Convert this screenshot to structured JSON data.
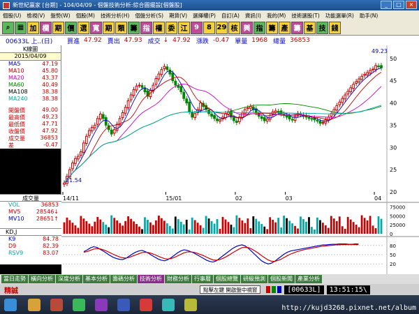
{
  "window": {
    "title": "新世紀贏家 [台期] - 104/04/09 - 個盤技術分析:綜合圖擺設[個盤股]"
  },
  "menu": [
    "個股(U)",
    "檢視(V)",
    "盤勢(W)",
    "個股(M)",
    "技術分析(H)",
    "個盤分析(S)",
    "期貨(V)",
    "選擇權(P)",
    "自訂(A)",
    "資訊(I)",
    "我的(M)",
    "技術選股(T)",
    "功能選單(R)",
    "助手(N)"
  ],
  "toolbar": [
    "加",
    "欄",
    "期",
    "價",
    "選",
    "寬",
    "期",
    "類",
    "籌",
    "指",
    "權",
    "委",
    "江",
    "9",
    "8",
    "29",
    "核",
    "興",
    "指",
    "籌",
    "產",
    "籌",
    "基",
    "技",
    "錢"
  ],
  "info": {
    "symbol": "00633L 上..(日)",
    "buy_label": "買進",
    "buy": "47.92",
    "sell_label": "賣出",
    "sell": "47.93",
    "trade_label": "成交",
    "trade": "47.92",
    "change_label": "漲跌",
    "change": "-0.47",
    "vol_label": "單量",
    "vol": "1968",
    "total_label": "總量",
    "total": "36853"
  },
  "side": {
    "header": "K線圖",
    "date": "2015/04/09",
    "ma": [
      {
        "label": "MA5",
        "value": "47.19",
        "color": "#0000cc"
      },
      {
        "label": "MA10",
        "value": "45.80",
        "color": "#cc0000"
      },
      {
        "label": "MA20",
        "value": "43.37",
        "color": "#cc00cc"
      },
      {
        "label": "MA60",
        "value": "40.49",
        "color": "#008800"
      },
      {
        "label": "MA108",
        "value": "38.38",
        "color": "#000000"
      },
      {
        "label": "MA240",
        "value": "38.38",
        "color": "#00aaaa"
      }
    ],
    "quote": [
      {
        "label": "開盤價",
        "value": "49.00"
      },
      {
        "label": "最高價",
        "value": "49.23"
      },
      {
        "label": "最低價",
        "value": "47.71"
      },
      {
        "label": "收盤價",
        "value": "47.92"
      },
      {
        "label": "成交量",
        "value": "36853"
      },
      {
        "label": "差",
        "value": "-0.47"
      }
    ]
  },
  "vol_panel": {
    "header": "成交量",
    "rows": [
      {
        "label": "VOL",
        "value": "36853",
        "color": "#00aaaa"
      },
      {
        "label": "MV5",
        "value": "28546↓",
        "color": "#cc0000"
      },
      {
        "label": "MV10",
        "value": "28651↑",
        "color": "#0000cc"
      }
    ]
  },
  "kd_panel": {
    "header": "KD,J",
    "rows": [
      {
        "label": "K9",
        "value": "84.78",
        "color": "#0000cc"
      },
      {
        "label": "D9",
        "value": "82.39",
        "color": "#cc0000"
      },
      {
        "label": "RSV9",
        "value": "83.07",
        "color": "#00aaaa"
      }
    ]
  },
  "chart_data": {
    "type": "candlestick",
    "price_axis": {
      "ticks": [
        "50",
        "45",
        "40",
        "35",
        "30",
        "25",
        "20"
      ],
      "min": 20,
      "max": 52
    },
    "x_ticks": [
      {
        "label": "14/11",
        "i": 0
      },
      {
        "label": "15/01",
        "i": 37
      },
      {
        "label": "02",
        "i": 62
      },
      {
        "label": "03",
        "i": 80
      },
      {
        "label": "04",
        "i": 112
      }
    ],
    "annotations": {
      "high": "49.23",
      "low": "21.54"
    },
    "closes": [
      22.0,
      23.5,
      25.0,
      26.5,
      27.5,
      28.0,
      29.0,
      31.0,
      32.5,
      33.8,
      34.5,
      35.0,
      36.5,
      37.5,
      36.5,
      35.0,
      34.0,
      33.0,
      34.0,
      35.2,
      36.5,
      37.8,
      39.0,
      40.5,
      41.8,
      43.0,
      43.8,
      44.0,
      43.5,
      42.5,
      41.5,
      42.8,
      44.0,
      45.5,
      46.5,
      47.5,
      48.2,
      47.5,
      46.5,
      45.0,
      44.0,
      43.5,
      42.5,
      41.0,
      40.0,
      38.0,
      36.8,
      37.6,
      38.5,
      40.0,
      39.2,
      38.5,
      37.6,
      37.0,
      36.5,
      36.0,
      36.2,
      36.8,
      37.6,
      38.0,
      36.8,
      36.0,
      35.6,
      36.8,
      37.7,
      38.5,
      38.9,
      39.2,
      38.5,
      37.8,
      37.0,
      36.5,
      36.0,
      36.4,
      37.2,
      38.0,
      38.2,
      38.0,
      37.6,
      37.2,
      36.8,
      36.4,
      36.2,
      37.0,
      37.6,
      37.4,
      37.0,
      36.8,
      36.6,
      36.4,
      36.2,
      36.0,
      35.4,
      35.6,
      36.2,
      36.8,
      37.6,
      38.5,
      39.4,
      40.2,
      41.0,
      41.8,
      42.6,
      43.4,
      44.2,
      44.8,
      45.4,
      46.0,
      46.4,
      46.8,
      47.3,
      47.6,
      48.4,
      48.2,
      47.9
    ],
    "volume_axis": {
      "ticks": [
        "75000",
        "50000",
        "25000",
        "0"
      ],
      "max": 80000
    },
    "kd_axis": {
      "ticks": [
        "80",
        "50",
        "20"
      ]
    },
    "kd_k": [
      60,
      65,
      72,
      76,
      74,
      68,
      62,
      55,
      48,
      42,
      38,
      35,
      34,
      38,
      45,
      52,
      58,
      62,
      64,
      60,
      55,
      48,
      42,
      36,
      32,
      30,
      34,
      40,
      48,
      56,
      62,
      66,
      64,
      60,
      56,
      50,
      44,
      38,
      32,
      28,
      26,
      30,
      38,
      46,
      54,
      62,
      70,
      76,
      80,
      82,
      78,
      70,
      60,
      50,
      40,
      30,
      24,
      20,
      22,
      28,
      36,
      44,
      52,
      58,
      62,
      64,
      66,
      68,
      70,
      72,
      74,
      76,
      78,
      80,
      82,
      82,
      83,
      84,
      84,
      85,
      85,
      85,
      84,
      84,
      85,
      84.78
    ],
    "kd_d": [
      58,
      60,
      64,
      68,
      70,
      69,
      66,
      62,
      57,
      52,
      47,
      43,
      40,
      39,
      41,
      45,
      49,
      53,
      57,
      58,
      57,
      54,
      50,
      45,
      41,
      37,
      36,
      37,
      41,
      46,
      51,
      56,
      59,
      59,
      58,
      55,
      51,
      47,
      42,
      37,
      33,
      32,
      34,
      38,
      43,
      49,
      56,
      62,
      68,
      73,
      74,
      73,
      68,
      62,
      55,
      47,
      40,
      33,
      29,
      28,
      31,
      35,
      41,
      47,
      52,
      56,
      60,
      63,
      66,
      68,
      70,
      72,
      74,
      76,
      78,
      79,
      80,
      81,
      82,
      82,
      83,
      83,
      83,
      83,
      83,
      82.39
    ]
  },
  "tabs": [
    "當日走勢",
    "橫向分析",
    "深度分析",
    "基本分析",
    "籌碼分析",
    "技術分析",
    "財務分析",
    "行事曆",
    "個股總覽",
    "研級預測",
    "個股新聞",
    "產業分析"
  ],
  "active_tab": "技術分析",
  "status": {
    "logo": "精誠",
    "msg": "點擊左鍵 開啟盤中視窗",
    "code": "[00633L]",
    "time": "13:51:15\\"
  },
  "watermark": "http://kujd3268.pixnet.net/album"
}
